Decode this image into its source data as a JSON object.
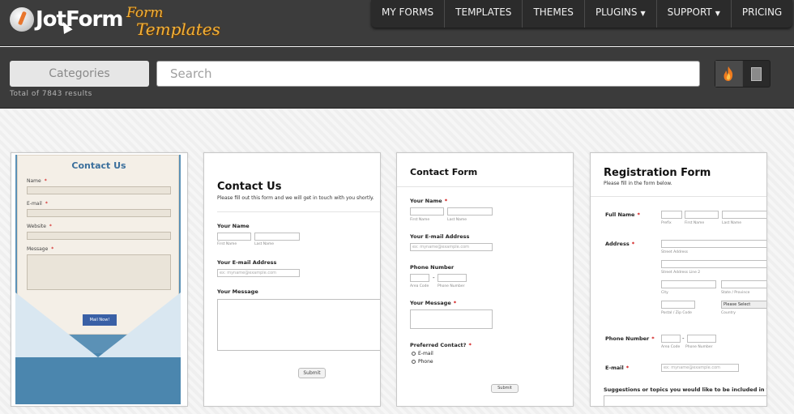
{
  "brand": {
    "name": "JotForm",
    "sub_line1": "Form",
    "sub_line2": "Templates"
  },
  "nav": [
    {
      "label": "MY FORMS",
      "caret": ""
    },
    {
      "label": "TEMPLATES",
      "caret": ""
    },
    {
      "label": "THEMES",
      "caret": ""
    },
    {
      "label": "PLUGINS",
      "caret": "▼"
    },
    {
      "label": "SUPPORT",
      "caret": "▼"
    },
    {
      "label": "PRICING",
      "caret": ""
    }
  ],
  "toolbar": {
    "categories_label": "Categories",
    "search_placeholder": "Search",
    "results_text": "Total of 7843 results",
    "view_popular_icon": "flame-icon",
    "view_recent_icon": "document-icon"
  },
  "cards": {
    "c1": {
      "title": "Contact Us",
      "labels": [
        "Name",
        "E-mail",
        "Website",
        "Message"
      ],
      "required": "*",
      "button": "Mail Now!"
    },
    "c2": {
      "title": "Contact Us",
      "subtitle": "Please fill out this form and we will get in touch with you shortly.",
      "name_label": "Your Name",
      "first_hint": "First Name",
      "last_hint": "Last Name",
      "email_label": "Your E-mail Address",
      "email_placeholder": "ex: myname@example.com",
      "message_label": "Your Message",
      "submit": "Submit"
    },
    "c3": {
      "title": "Contact Form",
      "name_label": "Your Name",
      "first_hint": "First Name",
      "last_hint": "Last Name",
      "email_label": "Your E-mail Address",
      "email_placeholder": "ex: myname@example.com",
      "phone_label": "Phone Number",
      "area_hint": "Area Code",
      "phone_hint": "Phone Number",
      "dash": "-",
      "message_label": "Your Message",
      "preferred_label": "Preferred Contact?",
      "radio1": "E-mail",
      "radio2": "Phone",
      "submit": "Submit",
      "required": "*"
    },
    "c4": {
      "title": "Registration Form",
      "subtitle": "Please fill in the form below.",
      "fullname_label": "Full Name",
      "prefix_hint": "Prefix",
      "first_hint": "First Name",
      "last_hint": "Last Name",
      "address_label": "Address",
      "street_hint": "Street Address",
      "street2_hint": "Street Address Line 2",
      "city_hint": "City",
      "state_hint": "State / Province",
      "postal_hint": "Postal / Zip Code",
      "country_hint": "Country",
      "country_select": "Please Select",
      "phone_label": "Phone Number",
      "area_hint": "Area Code",
      "phone_hint": "Phone Number",
      "dash": "-",
      "email_label": "E-mail",
      "email_placeholder": "ex: myname@example.com",
      "suggestions_label": "Suggestions or topics you would like to be included in the",
      "required": "*"
    }
  }
}
